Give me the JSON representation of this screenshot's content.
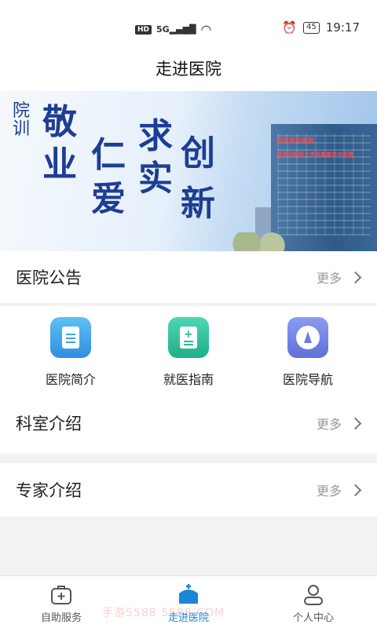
{
  "status_bar": {
    "network_badge": "HD",
    "signal": "5G",
    "battery": "45",
    "time": "19:17"
  },
  "nav": {
    "title": "走进医院"
  },
  "banner": {
    "side_label": "院训",
    "motto_chars": [
      "敬",
      "业",
      "仁",
      "爱",
      "求",
      "实",
      "创",
      "新"
    ],
    "building_sign_1": "南京市中医院",
    "building_sign_2": "南京中医药大学附属南京中医院"
  },
  "announcements": {
    "title": "医院公告",
    "more": "更多"
  },
  "quick_links": [
    {
      "label": "医院简介",
      "icon": "document-icon",
      "color": "#3ea4e6"
    },
    {
      "label": "就医指南",
      "icon": "medical-document-icon",
      "color": "#27b997"
    },
    {
      "label": "医院导航",
      "icon": "compass-icon",
      "color": "#6d7fde"
    }
  ],
  "departments": {
    "title": "科室介绍",
    "more": "更多"
  },
  "experts": {
    "title": "专家介绍",
    "more": "更多"
  },
  "tabbar": {
    "items": [
      {
        "label": "自助服务",
        "icon": "medical-kit-icon"
      },
      {
        "label": "走进医院",
        "icon": "hospital-icon"
      },
      {
        "label": "个人中心",
        "icon": "user-icon"
      }
    ],
    "active_color": "#1a86d8"
  },
  "watermark": "手游5588 5588.COM"
}
